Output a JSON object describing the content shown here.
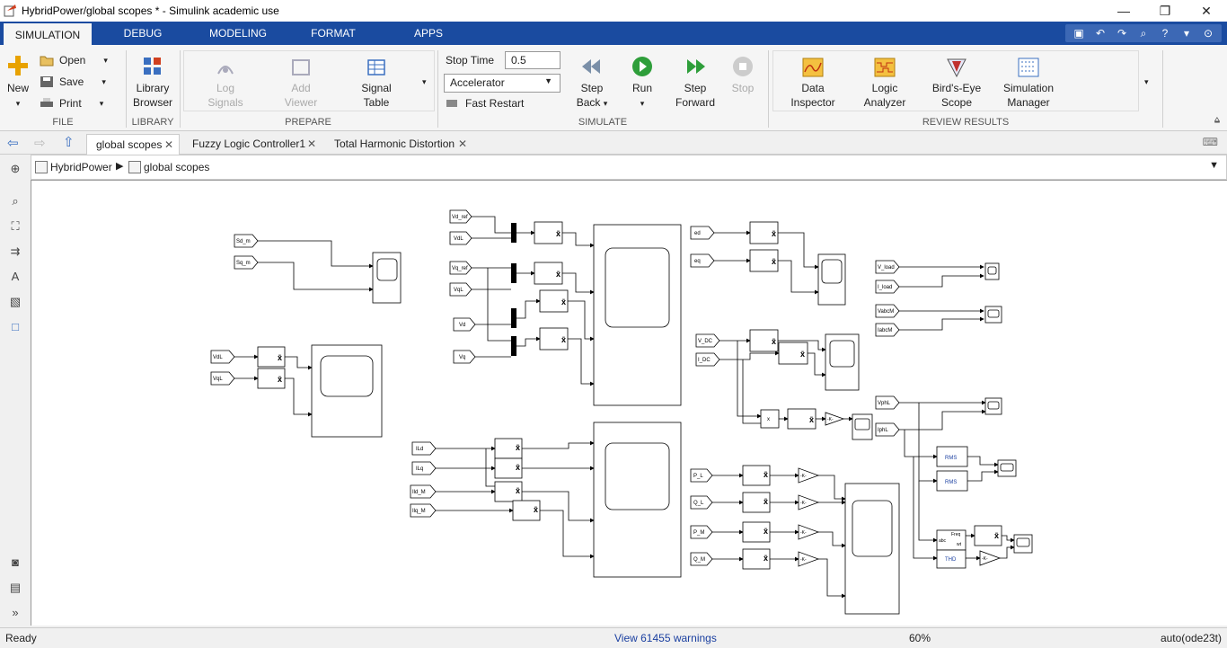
{
  "window": {
    "title": "HybridPower/global scopes * - Simulink academic use",
    "minimize": "—",
    "maximize": "❐",
    "close": "✕"
  },
  "ribbon_tabs": [
    "SIMULATION",
    "DEBUG",
    "MODELING",
    "FORMAT",
    "APPS"
  ],
  "ribbon": {
    "file": {
      "new": "New",
      "open": "Open",
      "save": "Save",
      "print": "Print",
      "group": "FILE"
    },
    "library": {
      "browser_line1": "Library",
      "browser_line2": "Browser",
      "group": "LIBRARY"
    },
    "prepare": {
      "log_line1": "Log",
      "log_line2": "Signals",
      "add_line1": "Add",
      "add_line2": "Viewer",
      "table_line1": "Signal",
      "table_line2": "Table",
      "group": "PREPARE"
    },
    "simulate": {
      "stop_time_label": "Stop Time",
      "stop_time_value": "0.5",
      "mode": "Accelerator",
      "fast_restart": "Fast Restart",
      "step_back_line1": "Step",
      "step_back_line2": "Back",
      "run": "Run",
      "step_fwd_line1": "Step",
      "step_fwd_line2": "Forward",
      "stop": "Stop",
      "group": "SIMULATE"
    },
    "review": {
      "data_line1": "Data",
      "data_line2": "Inspector",
      "logic_line1": "Logic",
      "logic_line2": "Analyzer",
      "birds_line1": "Bird's-Eye",
      "birds_line2": "Scope",
      "sim_line1": "Simulation",
      "sim_line2": "Manager",
      "group": "REVIEW RESULTS"
    }
  },
  "model_tabs": [
    "global scopes",
    "Fuzzy Logic  Controller1",
    "Total Harmonic Distortion"
  ],
  "breadcrumb": {
    "root": "HybridPower",
    "current": "global scopes"
  },
  "diagram": {
    "labels": {
      "sd_m": "Sd_m",
      "sq_m": "Sq_m",
      "vdl": "VdL",
      "vql": "VqL",
      "vd_ref": "Vd_ref",
      "vdl2": "VdL",
      "vq_ref": "Vq_ref",
      "vql2": "VqL",
      "vd": "Vd",
      "vq": "Vq",
      "ed": "ed",
      "eq": "eq",
      "v_load": "V_load",
      "i_load": "I_load",
      "vabcm": "VabcM",
      "iabcm": "IabcM",
      "v_dc": "V_DC",
      "i_dc": "I_DC",
      "vphl": "VphL",
      "iphl": "IphL",
      "ild": "ILd",
      "ilq": "ILq",
      "ild_m": "Ild_M",
      "ilq_m": "Ilq_M",
      "p_l": "P_L",
      "q_l": "Q_L",
      "p_m": "P_M",
      "q_m": "Q_M",
      "rms": "RMS",
      "thd": "THD",
      "gain": "-K-",
      "freq": "Freq",
      "wt": "wt",
      "abc": "abc",
      "x": "x"
    }
  },
  "status": {
    "ready": "Ready",
    "warnings": "View 61455 warnings",
    "zoom": "60%",
    "solver": "auto(ode23t)"
  }
}
